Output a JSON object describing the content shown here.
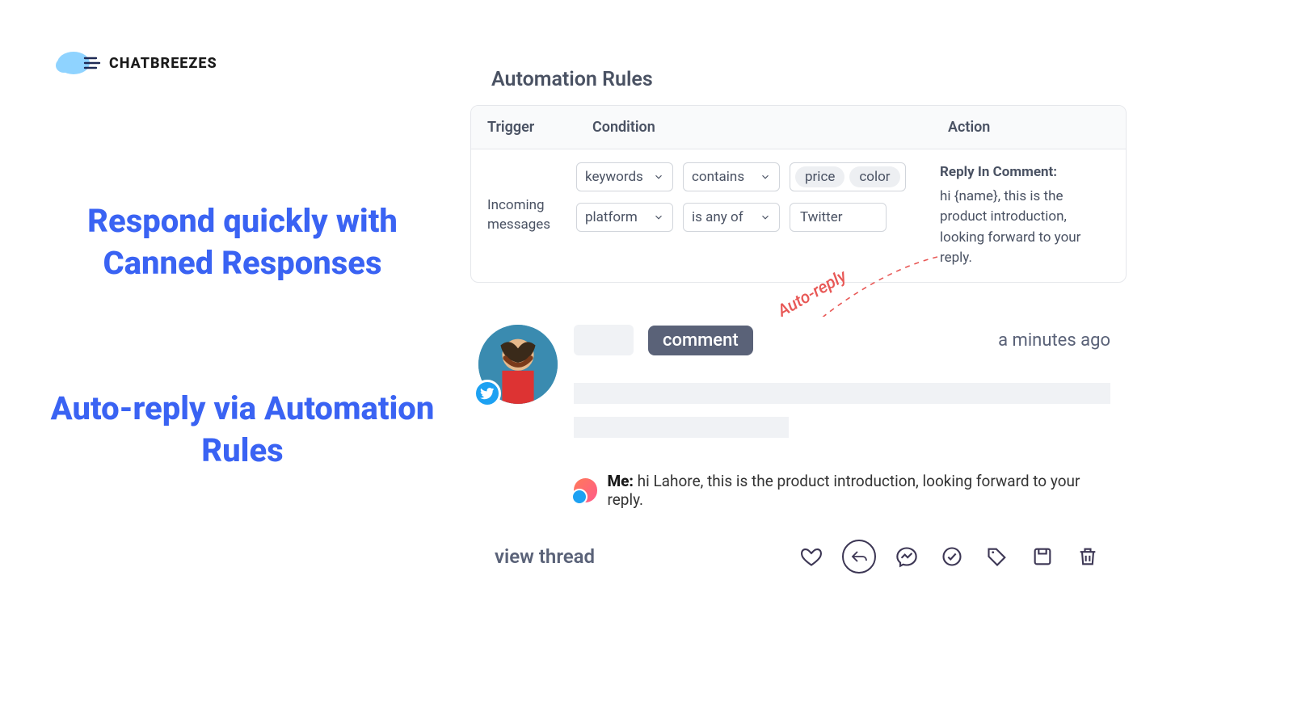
{
  "logo": {
    "text": "CHATBREEZES"
  },
  "headlines": {
    "h1": "Respond quickly with Canned Responses",
    "h2": "Auto-reply  via Automation Rules"
  },
  "rules": {
    "title": "Automation Rules",
    "columns": {
      "trigger": "Trigger",
      "condition": "Condition",
      "action": "Action"
    },
    "trigger_text": "Incoming messages",
    "row1": {
      "field": "keywords",
      "op": "contains",
      "values": [
        "price",
        "color"
      ]
    },
    "row2": {
      "field": "platform",
      "op": "is any of",
      "value": "Twitter"
    },
    "action_heading": "Reply In Comment:",
    "action_body": "hi {name}, this is the product introduction, looking forward to your reply."
  },
  "annotation": {
    "label": "Auto-reply"
  },
  "comment": {
    "badge": "comment",
    "time": "a minutes ago",
    "reply_author": "Me:",
    "reply_text": "hi Lahore, this is the product introduction, looking forward to your reply.",
    "view_thread": "view thread"
  }
}
